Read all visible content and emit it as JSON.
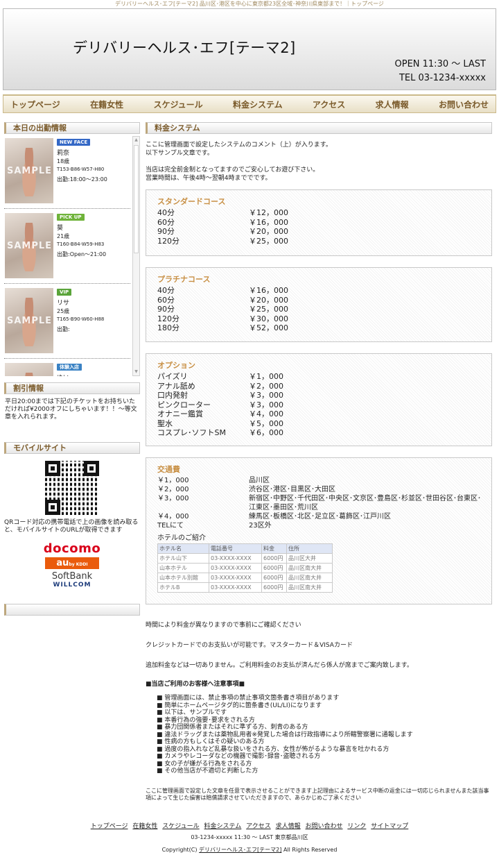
{
  "top_banner": "デリバリーヘルス･エフ[テーマ2] 品川区･港区を中心に東京都23区全域･神奈川県東部まで！｜トップページ",
  "header": {
    "title": "デリバリーヘルス･エフ[テーマ2]",
    "open": "OPEN 11:30 〜 LAST",
    "tel": "TEL 03-1234-xxxxx"
  },
  "nav": [
    "トップページ",
    "在籍女性",
    "スケジュール",
    "料金システム",
    "アクセス",
    "求人情報",
    "お問い合わせ"
  ],
  "sidebar": {
    "today_title": "本日の出勤情報",
    "sample_label": "SAMPLE",
    "girls": [
      {
        "badge": "NEW FACE",
        "badge_color": "#3468c6",
        "name": "莉奈",
        "age": "18歳",
        "size": "T153-B86-W57-H80",
        "time": "出勤:18:00〜23:00"
      },
      {
        "badge": "PICK UP",
        "badge_color": "#6fb33a",
        "name": "葵",
        "age": "21歳",
        "size": "T160-B84-W59-H83",
        "time": "出勤:Open〜21:00"
      },
      {
        "badge": "VIP",
        "badge_color": "#5aa43a",
        "name": "リサ",
        "age": "25歳",
        "size": "T165-B90-W60-H88",
        "time": "出勤:"
      },
      {
        "badge": "体験入店",
        "badge_color": "#3a82c4",
        "name": "ゆい",
        "age": "",
        "size": "",
        "time": ""
      }
    ],
    "discount_title": "割引情報",
    "discount_text": "平日20:00までは下記のチケットをお持ちいただければ¥2000オフにしちゃいます！！〜等文章を入れられます。",
    "mobile_title": "モバイルサイト",
    "mobile_text": "QRコード対応の携帯電話で上の画像を読み取ると、モバイルサイトのURLが取得できます",
    "carriers": {
      "docomo": "docomo",
      "au": "au",
      "au_sub": "by KDDI",
      "softbank": "SoftBank",
      "willcom": "WILLCOM"
    }
  },
  "main": {
    "title": "料金システム",
    "intro": [
      "ここに管理画面で設定したシステムのコメント（上）が入ります。",
      "以下サンプル文章です。",
      "",
      "当店は完全前金制となってますのでご安心してお遊び下さい。",
      "営業時間は、午後4時〜翌朝4時まででです。"
    ],
    "standard": {
      "title": "スタンダードコース",
      "rows": [
        [
          "40分",
          "￥12，000"
        ],
        [
          "60分",
          "￥16，000"
        ],
        [
          "90分",
          "￥20，000"
        ],
        [
          "120分",
          "￥25，000"
        ]
      ]
    },
    "platinum": {
      "title": "プラチナコース",
      "rows": [
        [
          "40分",
          "￥16，000"
        ],
        [
          "60分",
          "￥20，000"
        ],
        [
          "90分",
          "￥25，000"
        ],
        [
          "120分",
          "￥30，000"
        ],
        [
          "180分",
          "￥52，000"
        ]
      ]
    },
    "options": {
      "title": "オプション",
      "rows": [
        [
          "パイズリ",
          "￥1，000"
        ],
        [
          "アナル舐め",
          "￥2，000"
        ],
        [
          "口内発射",
          "￥3，000"
        ],
        [
          "ピンクローター",
          "￥3，000"
        ],
        [
          "オナニー鑑賞",
          "￥4，000"
        ],
        [
          "聖水",
          "￥5，000"
        ],
        [
          "コスプレ･ソフトSM",
          "￥6，000"
        ]
      ]
    },
    "transport": {
      "title": "交通費",
      "rows": [
        [
          "￥1，000",
          "品川区"
        ],
        [
          "￥2，000",
          "渋谷区･港区･目黒区･大田区"
        ],
        [
          "￥3，000",
          "新宿区･中野区･千代田区･中央区･文京区･豊島区･杉並区･世田谷区･台東区･江東区･墨田区･荒川区"
        ],
        [
          "￥4，000",
          "練馬区･板橋区･北区･足立区･葛飾区･江戸川区"
        ],
        [
          "TELにて",
          "23区外"
        ]
      ],
      "hotel_label": "ホテルのご紹介",
      "hotel_headers": [
        "ホテル名",
        "電話番号",
        "料金",
        "住所"
      ],
      "hotels": [
        [
          "ホテル山下",
          "03-XXXX-XXXX",
          "6000円",
          "品川区大井"
        ],
        [
          "山本ホテル",
          "03-XXXX-XXXX",
          "6000円",
          "品川区南大井"
        ],
        [
          "山本ホテル別館",
          "03-XXXX-XXXX",
          "6000円",
          "品川区南大井"
        ],
        [
          "ホテルB",
          "03-XXXX-XXXX",
          "6000円",
          "品川区南大井"
        ]
      ]
    },
    "notes": [
      "時間により料金が異なりますので事前にご確認ください",
      "クレジットカードでのお支払いが可能です。マスターカード＆VISAカード",
      "追加料金などは一切ありません。ご利用料金のお支払が済んだら係人が席までご案内致します。"
    ],
    "caution_title": "■当店ご利用のお客様へ注意事項■",
    "cautions": [
      "管理画面には、禁止事項の禁止事項文箇条書き項目があります",
      "簡単にホームページタグ的に箇条書き(UL/LI)になります",
      "以下は、サンプルです",
      "本番行為の強要･要求をされる方",
      "暴力団関係者またはそれに準ずる方、刺青のある方",
      "違法ドラッグまたは薬物乱用者※発覚した場合は行政指導により所轄警察署に通報します",
      "性病の方もしくはその疑いのある方",
      "過度の指入れなど乱暴な扱いをされる方、女性が怖がるような暴言を吐かれる方",
      "カメラやレコーダなどの機器で撮影･録音･盗聴される方",
      "女の子が嫌がる行為をされる方",
      "その他当店が不適切と判断した方"
    ],
    "footer_note": "ここに管理画面で設定した文章を任意で表示させることができます上記理由によるサービス中断の返金には一切応じられませんまた該当事項によって生じた損害は賠償請求させていただきますので、あらかじめご了承ください"
  },
  "footer": {
    "links": [
      "トップページ",
      "在籍女性",
      "スケジュール",
      "料金システム",
      "アクセス",
      "求人情報",
      "お問い合わせ",
      "リンク",
      "サイトマップ"
    ],
    "address": "03-1234-xxxxx 11:30 〜 LAST 東京都品川区",
    "copy_prefix": "Copyright(C)",
    "copy_link": "デリバリーヘルス･エフ[テーマ2]",
    "copy_suffix": "All Rights Reserved"
  }
}
